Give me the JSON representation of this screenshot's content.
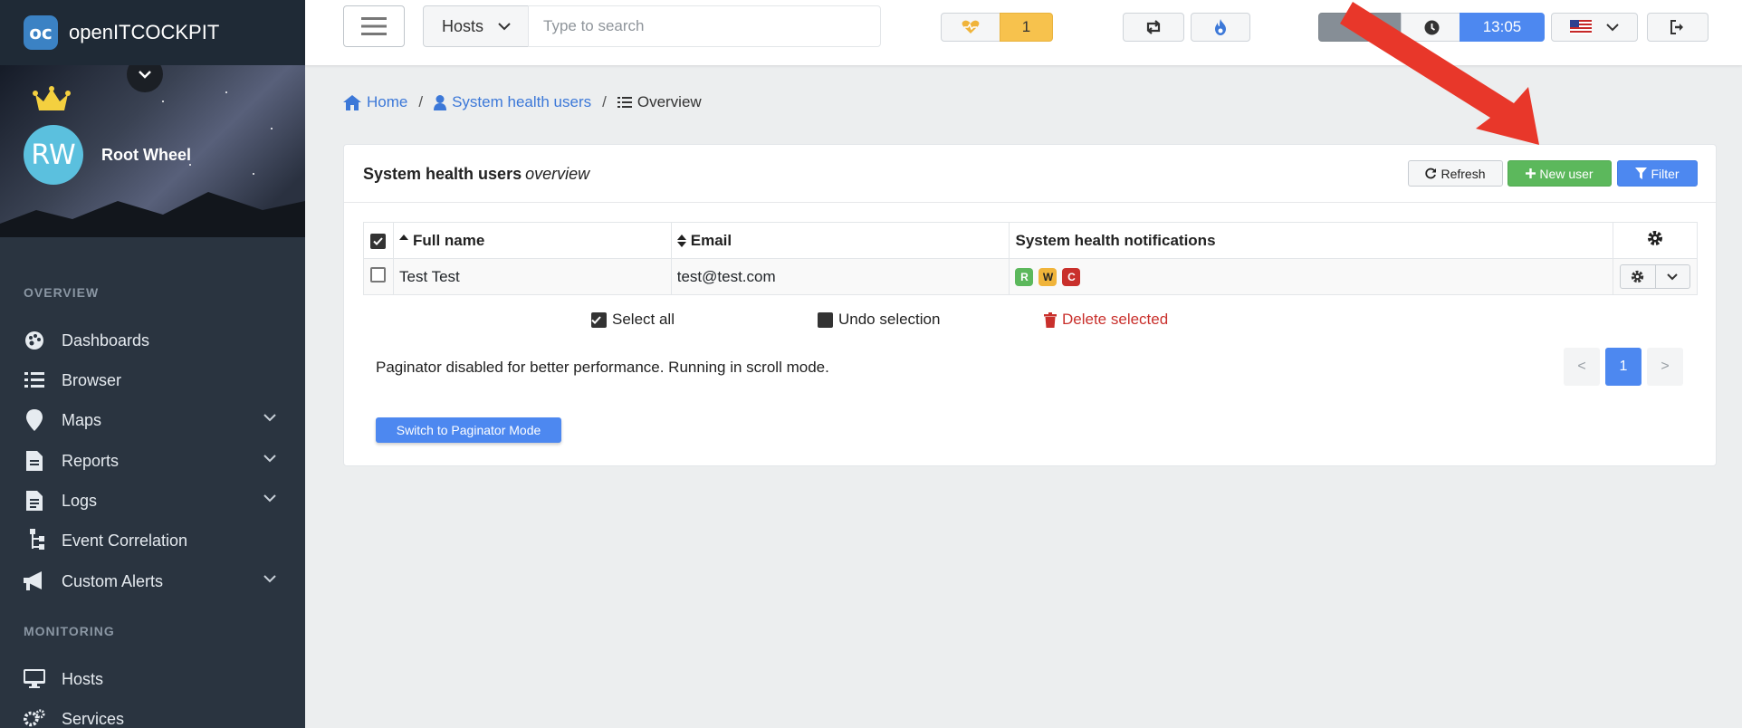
{
  "app": {
    "logo": "oc",
    "name": "openITCOCKPIT"
  },
  "user": {
    "initials": "RW",
    "name": "Root Wheel"
  },
  "sidebar": {
    "sections": [
      {
        "label": "OVERVIEW"
      },
      {
        "label": "MONITORING"
      }
    ],
    "items": [
      {
        "label": "Dashboards",
        "icon": "palette-icon",
        "chevron": false
      },
      {
        "label": "Browser",
        "icon": "list-icon",
        "chevron": false
      },
      {
        "label": "Maps",
        "icon": "map-marker-icon",
        "chevron": true
      },
      {
        "label": "Reports",
        "icon": "file-icon",
        "chevron": true
      },
      {
        "label": "Logs",
        "icon": "file-text-icon",
        "chevron": true
      },
      {
        "label": "Event Correlation",
        "icon": "sitemap-icon",
        "chevron": false
      },
      {
        "label": "Custom Alerts",
        "icon": "bullhorn-icon",
        "chevron": true
      },
      {
        "label": "Hosts",
        "icon": "desktop-icon",
        "chevron": false
      },
      {
        "label": "Services",
        "icon": "cogs-icon",
        "chevron": false
      }
    ]
  },
  "topbar": {
    "search_type": "Hosts",
    "search_placeholder": "Type to search",
    "health_count": "1",
    "num_badge": "1",
    "time": "13:05"
  },
  "breadcrumb": {
    "home": "Home",
    "section": "System health users",
    "current": "Overview"
  },
  "card": {
    "title": "System health users",
    "title_suffix": "overview",
    "refresh_label": "Refresh",
    "new_user_label": "New user",
    "filter_label": "Filter"
  },
  "table": {
    "columns": [
      "Full name",
      "Email",
      "System health notifications"
    ],
    "rows": [
      {
        "full_name": "Test Test",
        "email": "test@test.com",
        "notifications": [
          "R",
          "W",
          "C"
        ]
      }
    ]
  },
  "selection": {
    "select_all": "Select all",
    "undo": "Undo selection",
    "delete": "Delete selected"
  },
  "paginator": {
    "text": "Paginator disabled for better performance. Running in scroll mode.",
    "prev": "<",
    "page": "1",
    "next": ">",
    "switch_label": "Switch to Paginator Mode"
  },
  "colors": {
    "primary": "#4d88f0",
    "success": "#5cb85c",
    "warning": "#f0b43a",
    "danger": "#c9302c",
    "sidebar": "#2a3440",
    "annotation_arrow": "#e8372a"
  }
}
